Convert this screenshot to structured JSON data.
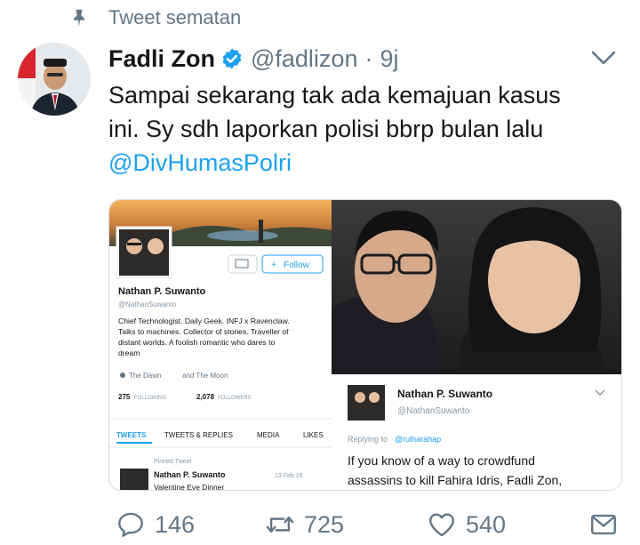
{
  "pinned": {
    "label": "Tweet sematan",
    "icon": "pin-icon"
  },
  "tweet": {
    "author_name": "Fadli Zon",
    "handle": "@fadlizon",
    "separator": "·",
    "time": "9j",
    "text_line1": "Sampai sekarang tak ada kemajuan kasus",
    "text_line2": "ini. Sy sdh laporkan polisi bbrp bulan lalu",
    "mention": "@DivHumasPolri"
  },
  "media": {
    "profile_name": "Nathan P. Suwanto",
    "profile_handle": "@NathanSuwanto",
    "follow_label": "Follow",
    "bio_line1": "Chief Technologist. Daily Geek. INFJ x Ravenclaw.",
    "bio_line2": "Talks to machines. Collector of stories. Traveller of",
    "bio_line3": "distant worlds. A foolish romantic who dares to",
    "bio_line4": "dream",
    "location": "The Dawn",
    "location_and": "and The Moon",
    "following_count": "275",
    "following_label": "FOLLOWING",
    "followers_count": "2,078",
    "followers_label": "FOLLOWERS",
    "tabs": [
      "TWEETS",
      "TWEETS & REPLIES",
      "MEDIA",
      "LIKES"
    ],
    "pinned_tweet_label": "Pinned Tweet",
    "pinned_author": "Nathan P. Suwanto",
    "pinned_date": "13 Feb 16",
    "pinned_snippet": "Valentine Eve Dinner",
    "reply_name": "Nathan P. Suwanto",
    "reply_handle": "@NathanSuwanto",
    "replying_to_label": "Replying to",
    "replying_to_handle": "@rulharahap",
    "reply_line1": "If you know of a way to crowdfund",
    "reply_line2": "assassins to kill Fahira Idris, Fadli Zon,"
  },
  "actions": {
    "reply_count": "146",
    "retweet_count": "725",
    "like_count": "540"
  },
  "colors": {
    "accent": "#1da1f2",
    "muted": "#657786",
    "text": "#14171a"
  }
}
